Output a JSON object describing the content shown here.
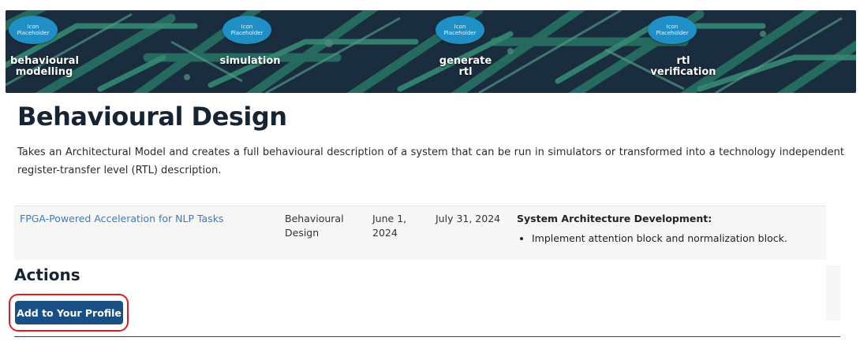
{
  "banner": {
    "steps": [
      {
        "badge": "Icon\nPlaceholder",
        "label": "behavioural\nmodelling"
      },
      {
        "badge": "Icon\nPlaceholder",
        "label": "simulation"
      },
      {
        "badge": "Icon\nPlaceholder",
        "label": "generate rtl"
      },
      {
        "badge": "Icon\nPlaceholder",
        "label": "rtl\nverification"
      }
    ]
  },
  "page": {
    "title": "Behavioural Design",
    "description": "Takes an Architectural Model and creates a full behavioural description of a system that can be run in simulators or transformed into a technology independent register-transfer level (RTL) description."
  },
  "project": {
    "name": "FPGA-Powered Acceleration for NLP Tasks",
    "stage": "Behavioural Design",
    "start_date": "June 1, 2024",
    "end_date": "July 31, 2024",
    "task_title": "System Architecture Development:",
    "tasks": [
      "Implement attention block and normalization block."
    ]
  },
  "actions": {
    "heading": "Actions",
    "add_button_label": "Add to Your Profile"
  },
  "colors": {
    "button": "#1a4f86",
    "link": "#3a7bbf",
    "highlight": "#e01b22",
    "badge": "#1f8fc6"
  }
}
